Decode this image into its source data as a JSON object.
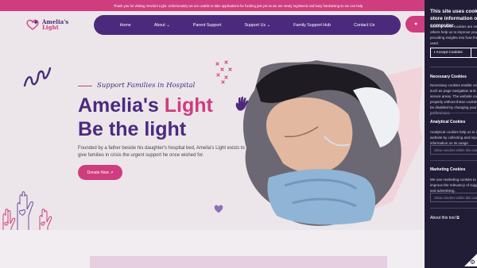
{
  "topbar": {
    "text": "Thank you for visiting Amelia's Light. Unfortunately we are unable to take applications for funding just yet as we are newly registered and busy fundraising so we can help."
  },
  "logo": {
    "line1": "Amelia's",
    "line2": "Light"
  },
  "nav": {
    "items": [
      "Home",
      "About ⌄",
      "Parent Support",
      "Support Us ⌄",
      "Family Support Hub",
      "Contact Us"
    ]
  },
  "header": {
    "donate_icon": "♥"
  },
  "hero": {
    "tagline": "Support Families in Hospital",
    "title_part1": "Amelia's ",
    "title_part2": "Light",
    "title_line2": "Be the light",
    "description": "Founded by a father beside his daughter's hospital bed, Amelia's Light exists to give families in crisis the urgent support he once wished for.",
    "donate_button": "Donate Now ↗"
  },
  "cookie_panel": {
    "title": "This site uses cookies to store information on your computer.",
    "intro": "Some of these cookies are essential, while others help us to improve your experience by providing insights into how the site is being used.",
    "accept_button": "I Accept Cookies",
    "necessary_title": "Necessary Cookies",
    "necessary_text": "Necessary cookies enable core functionality such as page navigation and access to secure areas. The website cannot function properly without these cookies, and can only be disabled by changing your browser preferences.",
    "analytical_title": "Analytical Cookies",
    "analytical_text": "Analytical cookies help us to improve our website by collecting and reporting information on its usage.",
    "show_vendors_1": "Show vendors within this category",
    "marketing_title": "Marketing Cookies",
    "marketing_text": "We use marketing cookies to help us improve the relevancy of suggested content and advertising.",
    "show_vendors_2": "Show vendors within this category",
    "about": "About this tool ⧉",
    "gear_icon": "⚙"
  },
  "colors": {
    "brand_purple": "#4b2a7e",
    "brand_pink": "#cf3d7e",
    "cookie_bg": "#221d36"
  }
}
